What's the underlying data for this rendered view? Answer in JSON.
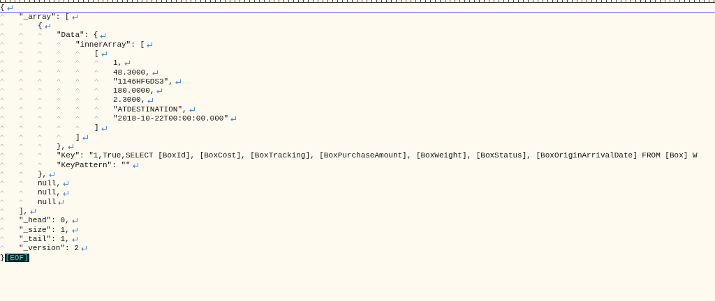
{
  "editor": {
    "lines": [
      {
        "text": "{",
        "eol": true,
        "current": true
      },
      {
        "text": "\t\"_array\": [",
        "eol": true,
        "current": false
      },
      {
        "text": "\t\t{",
        "eol": true,
        "current": false
      },
      {
        "text": "\t\t\t\"Data\": {",
        "eol": true,
        "current": false
      },
      {
        "text": "\t\t\t\t\"innerArray\": [",
        "eol": true,
        "current": false
      },
      {
        "text": "\t\t\t\t\t[",
        "eol": true,
        "current": false
      },
      {
        "text": "\t\t\t\t\t\t1,",
        "eol": true,
        "current": false
      },
      {
        "text": "\t\t\t\t\t\t48.3000,",
        "eol": true,
        "current": false
      },
      {
        "text": "\t\t\t\t\t\t\"1146HFGDS3\",",
        "eol": true,
        "current": false
      },
      {
        "text": "\t\t\t\t\t\t180.0000,",
        "eol": true,
        "current": false
      },
      {
        "text": "\t\t\t\t\t\t2.3000,",
        "eol": true,
        "current": false
      },
      {
        "text": "\t\t\t\t\t\t\"ATDESTINATION\",",
        "eol": true,
        "current": false
      },
      {
        "text": "\t\t\t\t\t\t\"2018-10-22T00:00:00.000\"",
        "eol": true,
        "current": false
      },
      {
        "text": "\t\t\t\t\t]",
        "eol": true,
        "current": false
      },
      {
        "text": "\t\t\t\t]",
        "eol": true,
        "current": false
      },
      {
        "text": "\t\t\t},",
        "eol": true,
        "current": false
      },
      {
        "text": "\t\t\t\"Key\": \"1,True,SELECT [BoxId], [BoxCost], [BoxTracking], [BoxPurchaseAmount], [BoxWeight], [BoxStatus], [BoxOriginArrivalDate] FROM [Box] W",
        "eol": false,
        "current": false
      },
      {
        "text": "\t\t\t\"KeyPattern\": \"\"",
        "eol": true,
        "current": false
      },
      {
        "text": "\t\t},",
        "eol": true,
        "current": false
      },
      {
        "text": "\t\tnull,",
        "eol": true,
        "current": false
      },
      {
        "text": "\t\tnull,",
        "eol": true,
        "current": false
      },
      {
        "text": "\t\tnull",
        "eol": true,
        "current": false
      },
      {
        "text": "\t],",
        "eol": true,
        "current": false
      },
      {
        "text": "\t\"_head\": 0,",
        "eol": true,
        "current": false
      },
      {
        "text": "\t\"_size\": 1,",
        "eol": true,
        "current": false
      },
      {
        "text": "\t\"_tail\": 1,",
        "eol": true,
        "current": false
      },
      {
        "text": "\t\"_version\": 2",
        "eol": true,
        "current": false
      },
      {
        "text": "}",
        "eol": false,
        "current": false,
        "eof_marker": "[EOF]"
      }
    ]
  }
}
